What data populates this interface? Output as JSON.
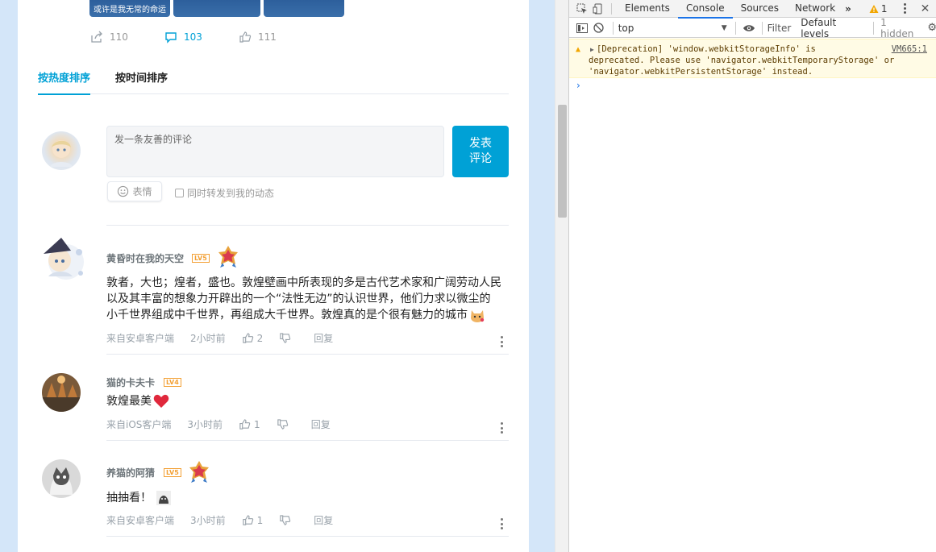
{
  "post": {
    "image_caption": "或许是我无常的命运",
    "stats": {
      "share": "110",
      "comment": "103",
      "like": "111"
    }
  },
  "sort_tabs": [
    "按热度排序",
    "按时间排序"
  ],
  "editor": {
    "placeholder": "发一条友善的评论",
    "submit_label": "发表\n评论",
    "emoji_label": "表情",
    "forward_label": "同时转发到我的动态"
  },
  "comments": [
    {
      "user": "黄昏时在我的天空",
      "level": "LV5",
      "text_lines": [
        "敦者，大也；煌者，盛也。敦煌壁画中所表现的多是古代艺术家和广阔劳动人民",
        "以及其丰富的想象力开辟出的一个“法性无边”的认识世界，他们力求以微尘的",
        "小千世界组成中千世界，再组成大千世界。敦煌真的是个很有魅力的城市"
      ],
      "source": "来自安卓客户端",
      "time": "2小时前",
      "likes": "2",
      "reply": "回复"
    },
    {
      "user": "猫的卡夫卡",
      "level": "LV4",
      "text_lines": [
        "敦煌最美"
      ],
      "source": "来自iOS客户端",
      "time": "3小时前",
      "likes": "1",
      "reply": "回复"
    },
    {
      "user": "养猫的阿猜",
      "level": "LV5",
      "text_lines": [
        "抽抽看！"
      ],
      "source": "来自安卓客户端",
      "time": "3小时前",
      "likes": "1",
      "reply": "回复"
    }
  ],
  "devtools": {
    "tabs": [
      "Elements",
      "Console",
      "Sources",
      "Network"
    ],
    "active_tab": "Console",
    "warning_count": "1",
    "context": "top",
    "filter_placeholder": "Filter",
    "levels": "Default levels",
    "hidden": "1 hidden",
    "message_lines": [
      "[Deprecation] 'window.webkitStorageInfo' is",
      "deprecated. Please use 'navigator.webkitTemporaryStorage' or",
      "'navigator.webkitPersistentStorage' instead."
    ],
    "message_source": "VM665:1",
    "prompt": "›"
  },
  "colors": {
    "accent": "#00a1d6",
    "bg_side": "#d4e6f9",
    "level_orange": "#f3a034",
    "warning_bg": "#fffbe5"
  }
}
